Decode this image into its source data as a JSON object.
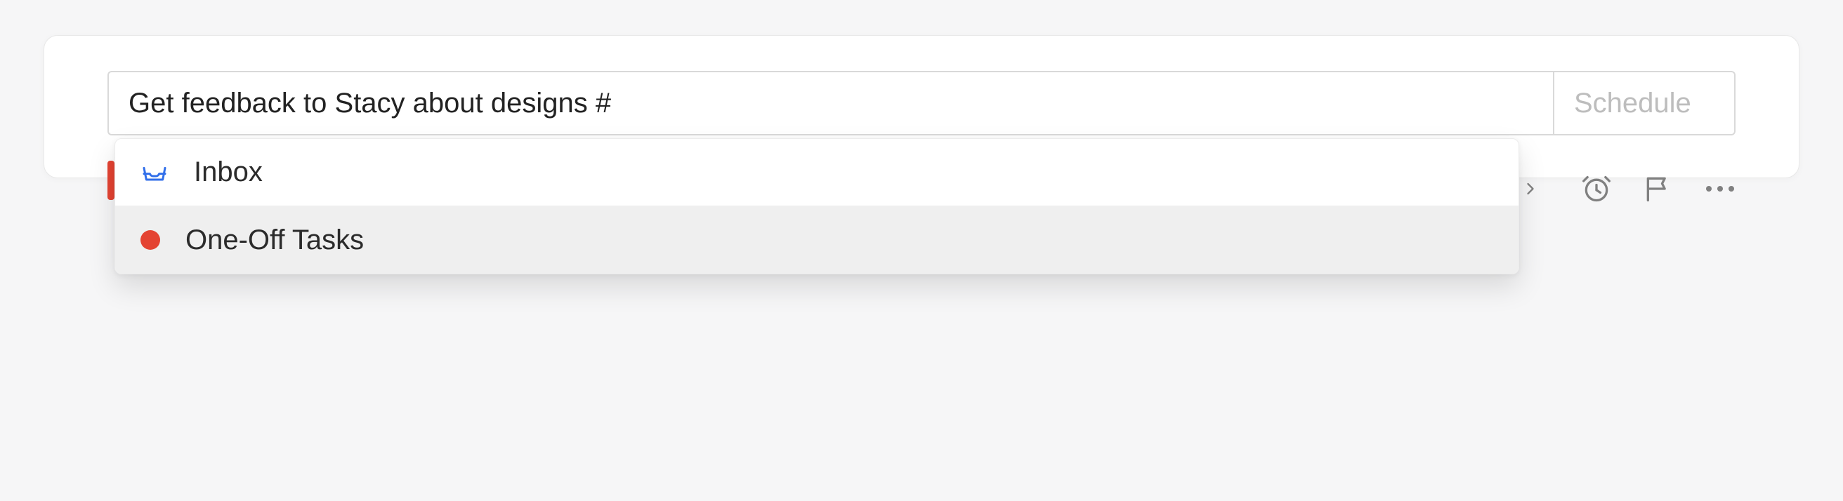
{
  "task": {
    "input_value": "Get feedback to Stacy about designs #",
    "schedule_label": "Schedule"
  },
  "dropdown": {
    "items": [
      {
        "label": "Inbox",
        "icon": "inbox"
      },
      {
        "label": "One-Off Tasks",
        "icon": "dot",
        "highlighted": true
      }
    ]
  },
  "colors": {
    "accent": "#e44332",
    "muted": "#808080",
    "inbox_icon": "#316fea"
  }
}
